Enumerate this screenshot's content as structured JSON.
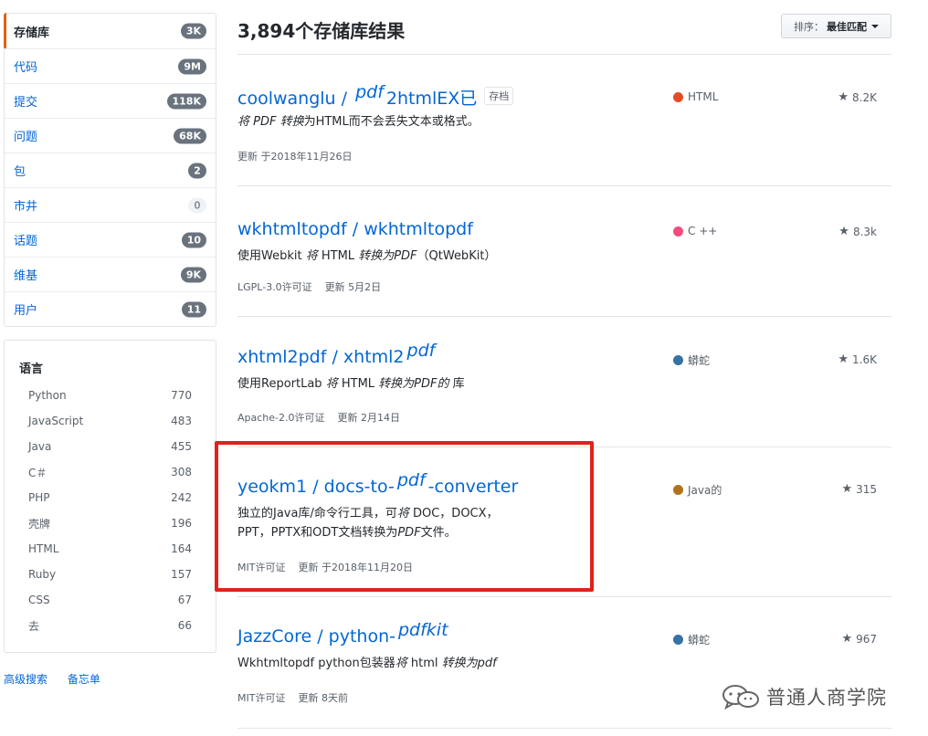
{
  "filter_menu": [
    {
      "label": "存储库",
      "count": "3K",
      "selected": true,
      "light": false
    },
    {
      "label": "代码",
      "count": "9M",
      "selected": false,
      "light": false
    },
    {
      "label": "提交",
      "count": "118K",
      "selected": false,
      "light": false
    },
    {
      "label": "问题",
      "count": "68K",
      "selected": false,
      "light": false
    },
    {
      "label": "包",
      "count": "2",
      "selected": false,
      "light": false
    },
    {
      "label": "市井",
      "count": "0",
      "selected": false,
      "light": true
    },
    {
      "label": "话题",
      "count": "10",
      "selected": false,
      "light": false
    },
    {
      "label": "维基",
      "count": "9K",
      "selected": false,
      "light": false
    },
    {
      "label": "用户",
      "count": "11",
      "selected": false,
      "light": false
    }
  ],
  "languages": {
    "title": "语言",
    "items": [
      {
        "name": "Python",
        "count": "770"
      },
      {
        "name": "JavaScript",
        "count": "483"
      },
      {
        "name": "Java",
        "count": "455"
      },
      {
        "name": "C＃",
        "count": "308"
      },
      {
        "name": "PHP",
        "count": "242"
      },
      {
        "name": "壳牌",
        "count": "196"
      },
      {
        "name": "HTML",
        "count": "164"
      },
      {
        "name": "Ruby",
        "count": "157"
      },
      {
        "name": "CSS",
        "count": "67"
      },
      {
        "name": "去",
        "count": "66"
      }
    ]
  },
  "footer": {
    "advanced_search": "高级搜索",
    "cheatsheet": "备忘单"
  },
  "results_title": "3,894个存储库结果",
  "sort": {
    "label": "排序：",
    "value": "最佳匹配"
  },
  "repos": [
    {
      "owner": "coolwanglu",
      "sep": " / ",
      "name_pre": "",
      "name_em": "pdf",
      "name_post": "2htmlEX已",
      "archived": "存档",
      "desc": [
        {
          "t": "将 PDF 转换",
          "i": true
        },
        {
          "t": "为HTML而不会丢失文本或格式。",
          "i": false
        }
      ],
      "meta": [
        "更新 于2018年11月26日"
      ],
      "lang": "HTML",
      "lang_color": "#e34c26",
      "stars": "8.2K"
    },
    {
      "owner": "wkhtmltopdf",
      "sep": " / ",
      "name_pre": "wkhtmltopdf",
      "name_em": "",
      "name_post": "",
      "archived": "",
      "desc": [
        {
          "t": "使用Webkit ",
          "i": false
        },
        {
          "t": "将",
          "i": true
        },
        {
          "t": " HTML ",
          "i": false
        },
        {
          "t": "转换为PDF",
          "i": true
        },
        {
          "t": "（QtWebKit）",
          "i": false
        }
      ],
      "meta": [
        "LGPL-3.0许可证",
        "更新 5月2日"
      ],
      "lang": "C ++",
      "lang_color": "#f34b7d",
      "stars": "8.3k"
    },
    {
      "owner": "xhtml2pdf",
      "sep": " / ",
      "name_pre": "xhtml2",
      "name_em": "pdf",
      "name_post": "",
      "archived": "",
      "desc": [
        {
          "t": "使用ReportLab ",
          "i": false
        },
        {
          "t": "将",
          "i": true
        },
        {
          "t": " HTML ",
          "i": false
        },
        {
          "t": "转换为PDF的",
          "i": true
        },
        {
          "t": " 库",
          "i": false
        }
      ],
      "meta": [
        "Apache-2.0许可证",
        "更新 2月14日"
      ],
      "lang": "蟒蛇",
      "lang_color": "#3572a5",
      "stars": "1.6K"
    },
    {
      "owner": "yeokm1",
      "sep": " / ",
      "name_pre": "docs-to-",
      "name_em": "pdf",
      "name_post": "-converter",
      "archived": "",
      "desc": [
        {
          "t": "独立的Java库/命令行工具，可",
          "i": false
        },
        {
          "t": "将",
          "i": true
        },
        {
          "t": " DOC，DOCX，PPT，PPTX和ODT文档转换为",
          "i": false
        },
        {
          "t": "PDF",
          "i": true
        },
        {
          "t": "文件。",
          "i": false
        }
      ],
      "meta": [
        "MIT许可证",
        "更新 于2018年11月20日"
      ],
      "lang": "Java的",
      "lang_color": "#b07219",
      "stars": "315"
    },
    {
      "owner": "JazzCore",
      "sep": " / ",
      "name_pre": "python-",
      "name_em": "pdfkit",
      "name_post": "",
      "archived": "",
      "desc": [
        {
          "t": "Wkhtmltopdf python包装器",
          "i": false
        },
        {
          "t": "将",
          "i": true
        },
        {
          "t": " html ",
          "i": false
        },
        {
          "t": "转换为pdf",
          "i": true
        }
      ],
      "meta": [
        "MIT许可证",
        "更新 8天前"
      ],
      "lang": "蟒蛇",
      "lang_color": "#3572a5",
      "stars": "967"
    }
  ],
  "watermark": {
    "text": "普通人商学院",
    "icon": "wechat-icon"
  },
  "colors": {
    "link": "#0366d6",
    "highlight_box": "#e0221b",
    "selected_accent": "#e36209"
  }
}
